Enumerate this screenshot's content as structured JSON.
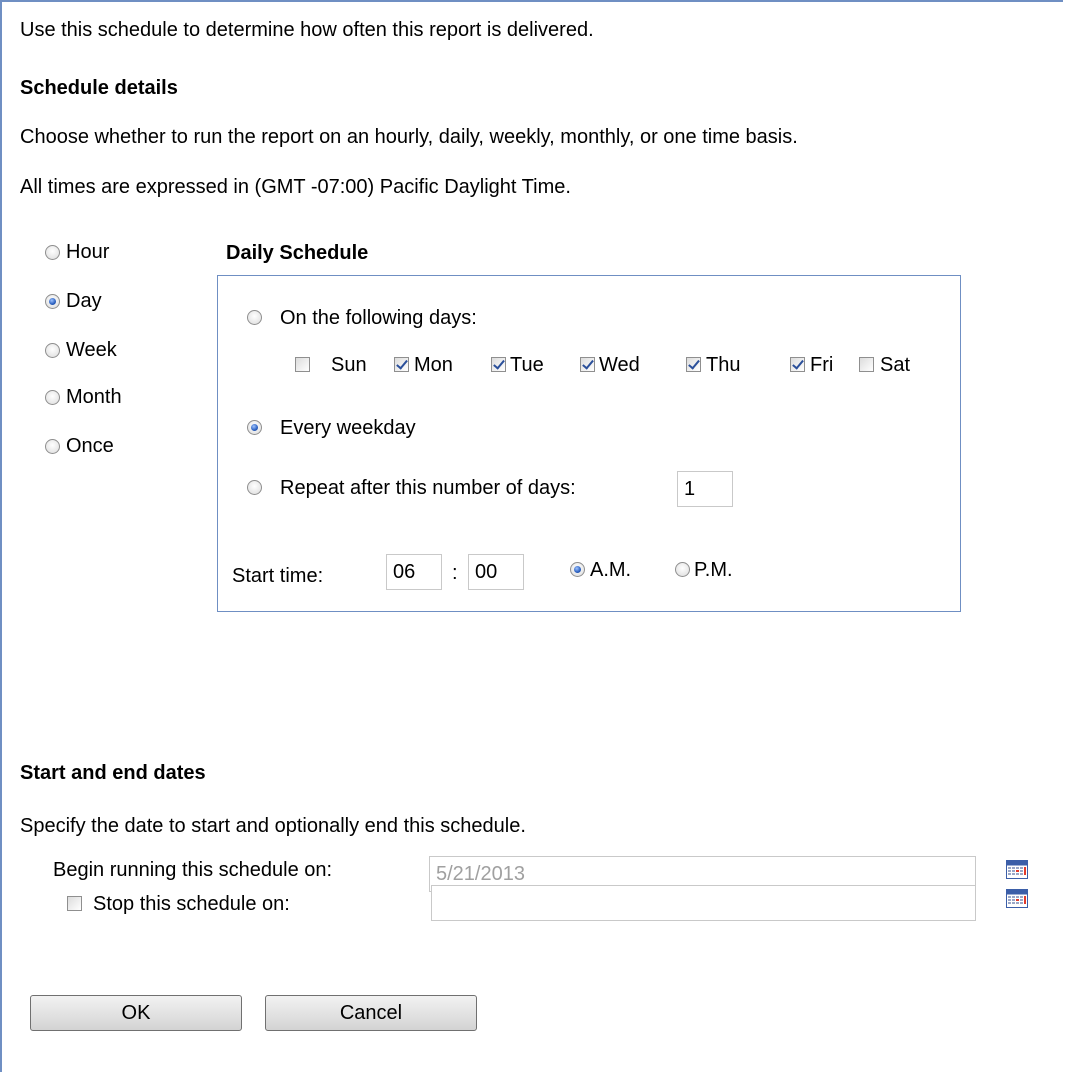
{
  "intro": "Use this schedule to determine how often this report is delivered.",
  "schedule_details": {
    "heading": "Schedule details",
    "description": "Choose whether to run the report on an hourly, daily, weekly, monthly, or one time basis.",
    "timezone": "All times are expressed in (GMT -07:00) Pacific Daylight Time."
  },
  "frequency": {
    "selected": "Day",
    "options": [
      {
        "label": "Hour",
        "selected": false
      },
      {
        "label": "Day",
        "selected": true
      },
      {
        "label": "Week",
        "selected": false
      },
      {
        "label": "Month",
        "selected": false
      },
      {
        "label": "Once",
        "selected": false
      }
    ]
  },
  "daily_schedule": {
    "heading": "Daily Schedule",
    "option_following_days": "On the following days:",
    "days": [
      {
        "label": "Sun",
        "checked": false
      },
      {
        "label": "Mon",
        "checked": true
      },
      {
        "label": "Tue",
        "checked": true
      },
      {
        "label": "Wed",
        "checked": true
      },
      {
        "label": "Thu",
        "checked": true
      },
      {
        "label": "Fri",
        "checked": true
      },
      {
        "label": "Sat",
        "checked": false
      }
    ],
    "option_every_weekday": "Every weekday",
    "option_repeat": "Repeat after this number of days:",
    "repeat_value": "1",
    "selected_option": "Every weekday",
    "start_time_label": "Start time:",
    "hour": "06",
    "separator": ":",
    "minute": "00",
    "am_label": "A.M.",
    "pm_label": "P.M.",
    "meridiem_selected": "A.M."
  },
  "dates": {
    "heading": "Start and end dates",
    "description": "Specify the date to start and optionally end this schedule.",
    "begin_label": "Begin running this schedule on:",
    "begin_value": "5/21/2013",
    "stop_label": "Stop this schedule on:",
    "stop_checked": false,
    "stop_value": ""
  },
  "buttons": {
    "ok": "OK",
    "cancel": "Cancel"
  },
  "icons": {
    "calendar": "calendar-icon"
  }
}
